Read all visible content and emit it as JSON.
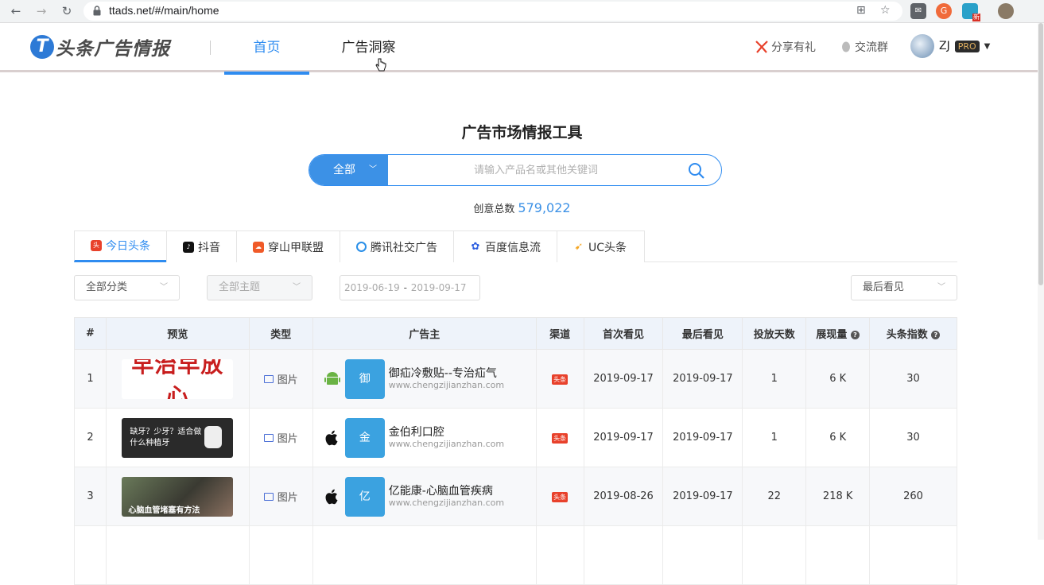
{
  "browser": {
    "url": "ttads.net/#/main/home",
    "ext_badge": "新"
  },
  "header": {
    "logo_text": "头条广告情报",
    "nav": [
      {
        "label": "首页",
        "active": true
      },
      {
        "label": "广告洞察",
        "active": false
      }
    ],
    "share_label": "分享有礼",
    "group_label": "交流群",
    "user_name": "ZJ",
    "user_badge": "PRO",
    "accent": "#2f8cf0"
  },
  "main": {
    "title": "广告市场情报工具",
    "search": {
      "scope": "全部",
      "placeholder": "请输入产品名或其他关键词"
    },
    "total_label": "创意总数",
    "total_value": "579,022"
  },
  "platform_tabs": [
    {
      "label": "今日头条",
      "icon": "toutiao-icon",
      "active": true
    },
    {
      "label": "抖音",
      "icon": "douyin-icon",
      "active": false
    },
    {
      "label": "穿山甲联盟",
      "icon": "pangle-icon",
      "active": false
    },
    {
      "label": "腾讯社交广告",
      "icon": "tencent-icon",
      "active": false
    },
    {
      "label": "百度信息流",
      "icon": "baidu-icon",
      "active": false
    },
    {
      "label": "UC头条",
      "icon": "uc-icon",
      "active": false
    }
  ],
  "filters": {
    "category": "全部分类",
    "theme": "全部主题",
    "date_start": "2019-06-19",
    "date_sep": "-",
    "date_end": "2019-09-17",
    "sort": "最后看见"
  },
  "table": {
    "headers": [
      "#",
      "预览",
      "类型",
      "广告主",
      "渠道",
      "首次看见",
      "最后看见",
      "投放天数",
      "展现量",
      "头条指数"
    ],
    "rows": [
      {
        "index": "1",
        "preview_text": "早治早放心",
        "type": "图片",
        "os": "android",
        "logo_char": "御",
        "name": "御疝冷敷贴--专治疝气",
        "url": "www.chengzijianzhan.com",
        "channel": "头条",
        "first_seen": "2019-09-17",
        "last_seen": "2019-09-17",
        "days": "1",
        "impressions": "6 K",
        "index_score": "30"
      },
      {
        "index": "2",
        "preview_text": "缺牙？少牙？适合做什么种植牙",
        "type": "图片",
        "os": "ios",
        "logo_char": "金",
        "name": "金伯利口腔",
        "url": "www.chengzijianzhan.com",
        "channel": "头条",
        "first_seen": "2019-09-17",
        "last_seen": "2019-09-17",
        "days": "1",
        "impressions": "6 K",
        "index_score": "30"
      },
      {
        "index": "3",
        "preview_text": "心脑血管堵塞有方法",
        "type": "图片",
        "os": "ios",
        "logo_char": "亿",
        "name": "亿能康-心脑血管疾病",
        "url": "www.chengzijianzhan.com",
        "channel": "头条",
        "first_seen": "2019-08-26",
        "last_seen": "2019-09-17",
        "days": "22",
        "impressions": "218 K",
        "index_score": "260"
      }
    ]
  }
}
